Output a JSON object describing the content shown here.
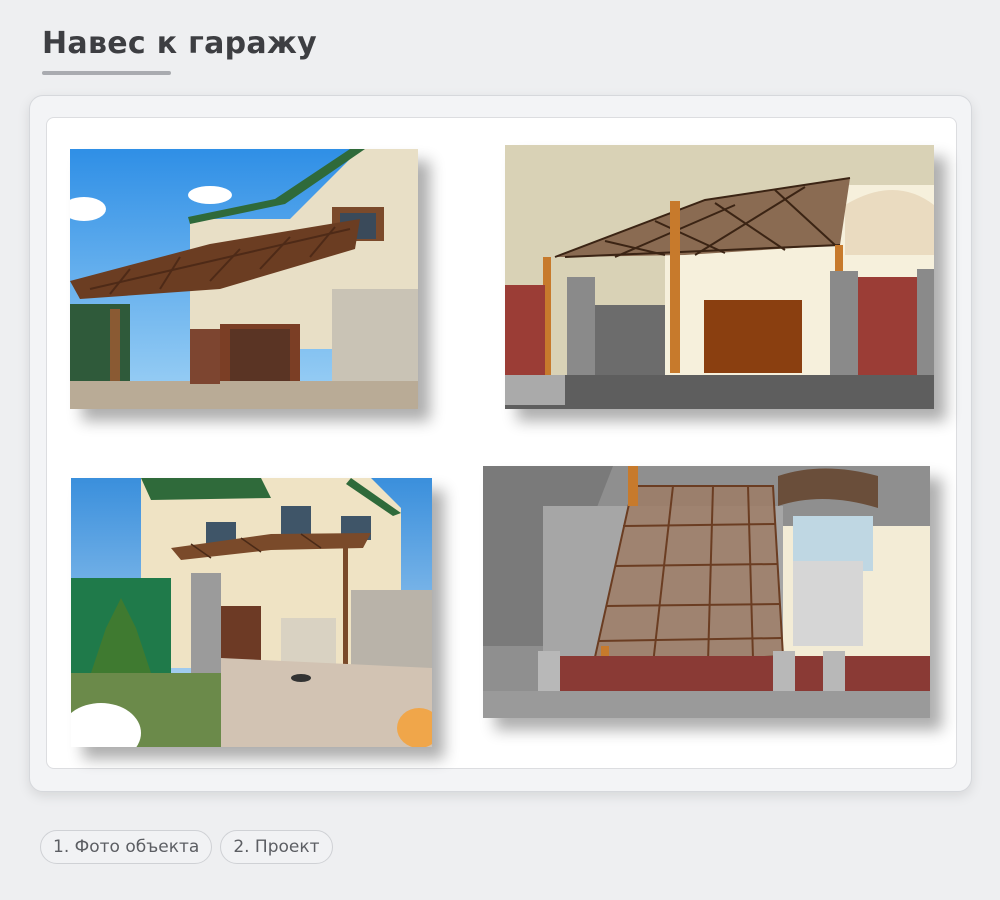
{
  "page": {
    "title": "Навес к гаражу"
  },
  "gallery": {
    "images": [
      {
        "id": "photo-1",
        "kind": "photo"
      },
      {
        "id": "render-1",
        "kind": "3d-render"
      },
      {
        "id": "photo-2",
        "kind": "photo"
      },
      {
        "id": "render-2",
        "kind": "3d-render"
      }
    ]
  },
  "tabs": [
    {
      "label": "1. Фото объекта"
    },
    {
      "label": "2. Проект"
    }
  ],
  "colors": {
    "background": "#eeeff1",
    "canopy_brown": "#7a4a2a",
    "title": "#3d3e42"
  }
}
